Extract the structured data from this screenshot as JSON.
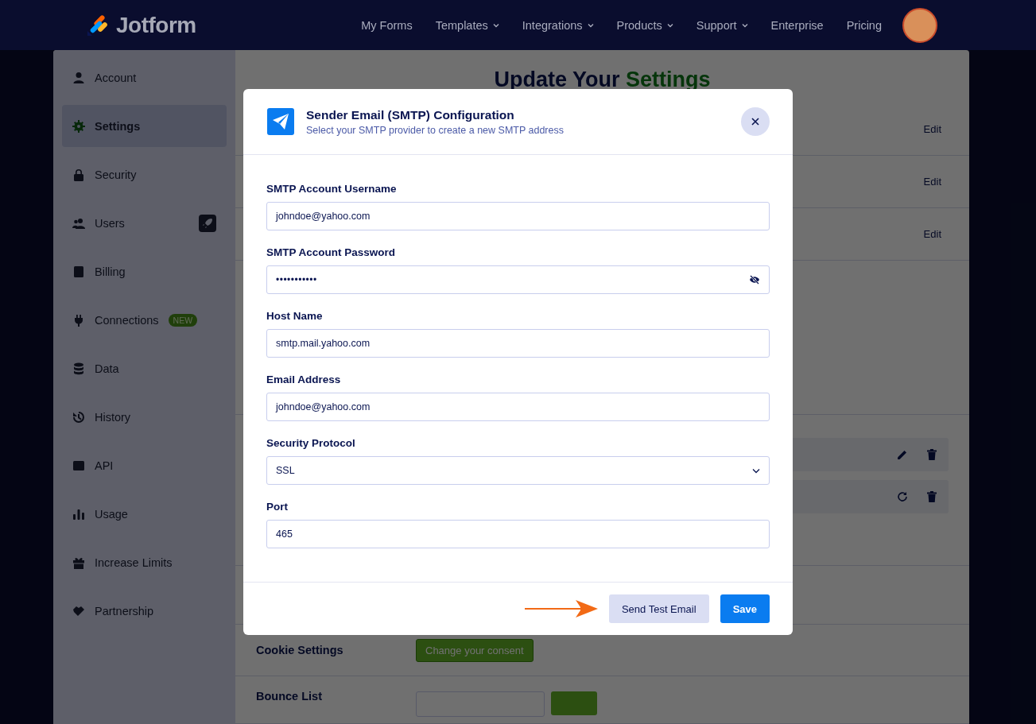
{
  "nav": {
    "brand": "Jotform",
    "links": [
      {
        "label": "My Forms",
        "dropdown": false
      },
      {
        "label": "Templates",
        "dropdown": true
      },
      {
        "label": "Integrations",
        "dropdown": true
      },
      {
        "label": "Products",
        "dropdown": true
      },
      {
        "label": "Support",
        "dropdown": true
      },
      {
        "label": "Enterprise",
        "dropdown": false
      },
      {
        "label": "Pricing",
        "dropdown": false
      }
    ]
  },
  "sidebar": {
    "items": [
      {
        "label": "Account",
        "selected": false
      },
      {
        "label": "Settings",
        "selected": true
      },
      {
        "label": "Security",
        "selected": false
      },
      {
        "label": "Users",
        "selected": false
      },
      {
        "label": "Billing",
        "selected": false
      },
      {
        "label": "Connections",
        "selected": false,
        "badge": "NEW"
      },
      {
        "label": "Data",
        "selected": false
      },
      {
        "label": "History",
        "selected": false
      },
      {
        "label": "API",
        "selected": false
      },
      {
        "label": "Usage",
        "selected": false
      },
      {
        "label": "Increase Limits",
        "selected": false
      },
      {
        "label": "Partnership",
        "selected": false
      }
    ]
  },
  "page": {
    "heading_start": "Update Your",
    "heading_highlight": "Settings",
    "edit_links": [
      "Edit",
      "Edit",
      "Edit"
    ],
    "smtp_rows": [
      {
        "kind": "edit"
      },
      {
        "kind": "refresh"
      }
    ],
    "cookie": {
      "label": "Cookie Settings",
      "button": "Change your consent"
    },
    "bounce": {
      "label": "Bounce List"
    }
  },
  "modal": {
    "title": "Sender Email (SMTP) Configuration",
    "subtitle": "Select your SMTP provider to create a new SMTP address",
    "fields": [
      {
        "label": "SMTP Account Username",
        "kind": "text",
        "value": "johndoe@yahoo.com"
      },
      {
        "label": "SMTP Account Password",
        "kind": "password",
        "value": "•••••••••••"
      },
      {
        "label": "Host Name",
        "kind": "text",
        "value": "smtp.mail.yahoo.com"
      },
      {
        "label": "Email Address",
        "kind": "text",
        "value": "johndoe@yahoo.com"
      },
      {
        "label": "Security Protocol",
        "kind": "select",
        "value": "SSL"
      },
      {
        "label": "Port",
        "kind": "text",
        "value": "465"
      }
    ],
    "buttons": [
      {
        "label": "Send Test Email",
        "kind": "secondary"
      },
      {
        "label": "Save",
        "kind": "primary"
      }
    ]
  }
}
